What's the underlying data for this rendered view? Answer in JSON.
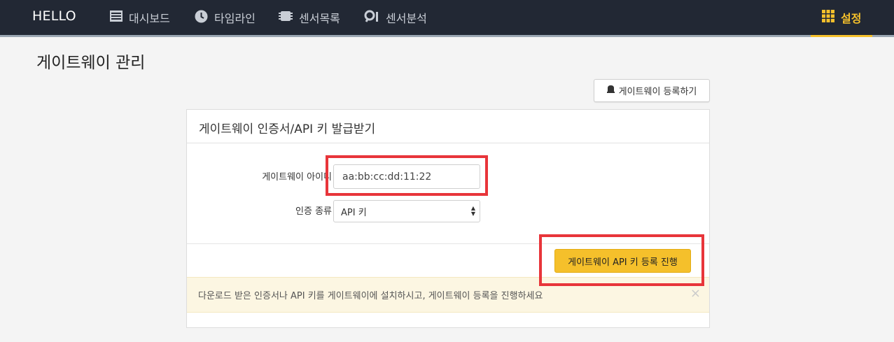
{
  "nav": {
    "brand": "HELLO",
    "items": [
      {
        "label": "대시보드",
        "icon": "dashboard-icon"
      },
      {
        "label": "타임라인",
        "icon": "clock-icon"
      },
      {
        "label": "센서목록",
        "icon": "chip-icon"
      },
      {
        "label": "센서분석",
        "icon": "analysis-icon"
      }
    ],
    "settings": {
      "label": "설정",
      "icon": "grid-icon"
    }
  },
  "page": {
    "title": "게이트웨이 관리",
    "register_button": "게이트웨이 등록하기"
  },
  "panel": {
    "title": "게이트웨이 인증서/API 키 발급받기",
    "gateway_id_label": "게이트웨이 아이디",
    "gateway_id_value": "aa:bb:cc:dd:11:22",
    "auth_type_label": "인증 종류",
    "auth_type_value": "API 키",
    "submit_button": "게이트웨이 API 키 등록 진행",
    "alert_text": "다운로드 받은 인증서나 API 키를 게이트웨이에 설치하시고, 게이트웨이 등록을 진행하세요",
    "alert_close": "×"
  },
  "colors": {
    "nav_bg": "#222834",
    "accent": "#f5c02b",
    "highlight": "#e8353a",
    "alert_bg": "#fcf6e2"
  }
}
